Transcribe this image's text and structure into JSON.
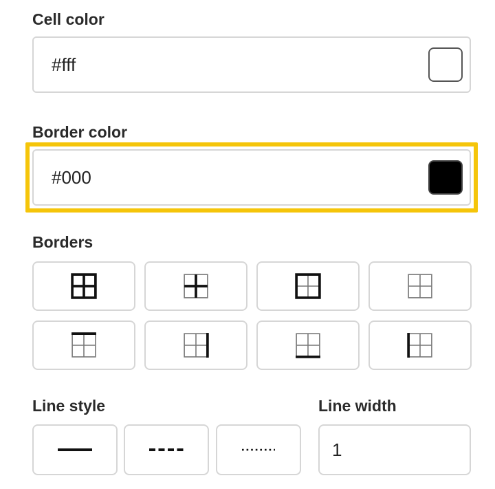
{
  "cell_color": {
    "label": "Cell color",
    "value": "#fff",
    "swatch_color": "#ffffff"
  },
  "border_color": {
    "label": "Border color",
    "value": "#000",
    "swatch_color": "#000000",
    "focused": true,
    "focus_ring_color": "#f5c50a"
  },
  "borders": {
    "label": "Borders",
    "options": [
      {
        "icon": "all-borders-icon"
      },
      {
        "icon": "inner-borders-icon"
      },
      {
        "icon": "outer-borders-icon"
      },
      {
        "icon": "no-borders-icon"
      },
      {
        "icon": "top-border-icon"
      },
      {
        "icon": "right-border-icon"
      },
      {
        "icon": "bottom-border-icon"
      },
      {
        "icon": "left-border-icon"
      }
    ]
  },
  "line_style": {
    "label": "Line style",
    "options": [
      {
        "icon": "solid-line-icon"
      },
      {
        "icon": "dashed-line-icon"
      },
      {
        "icon": "dotted-line-icon"
      }
    ]
  },
  "line_width": {
    "label": "Line width",
    "value": "1"
  }
}
